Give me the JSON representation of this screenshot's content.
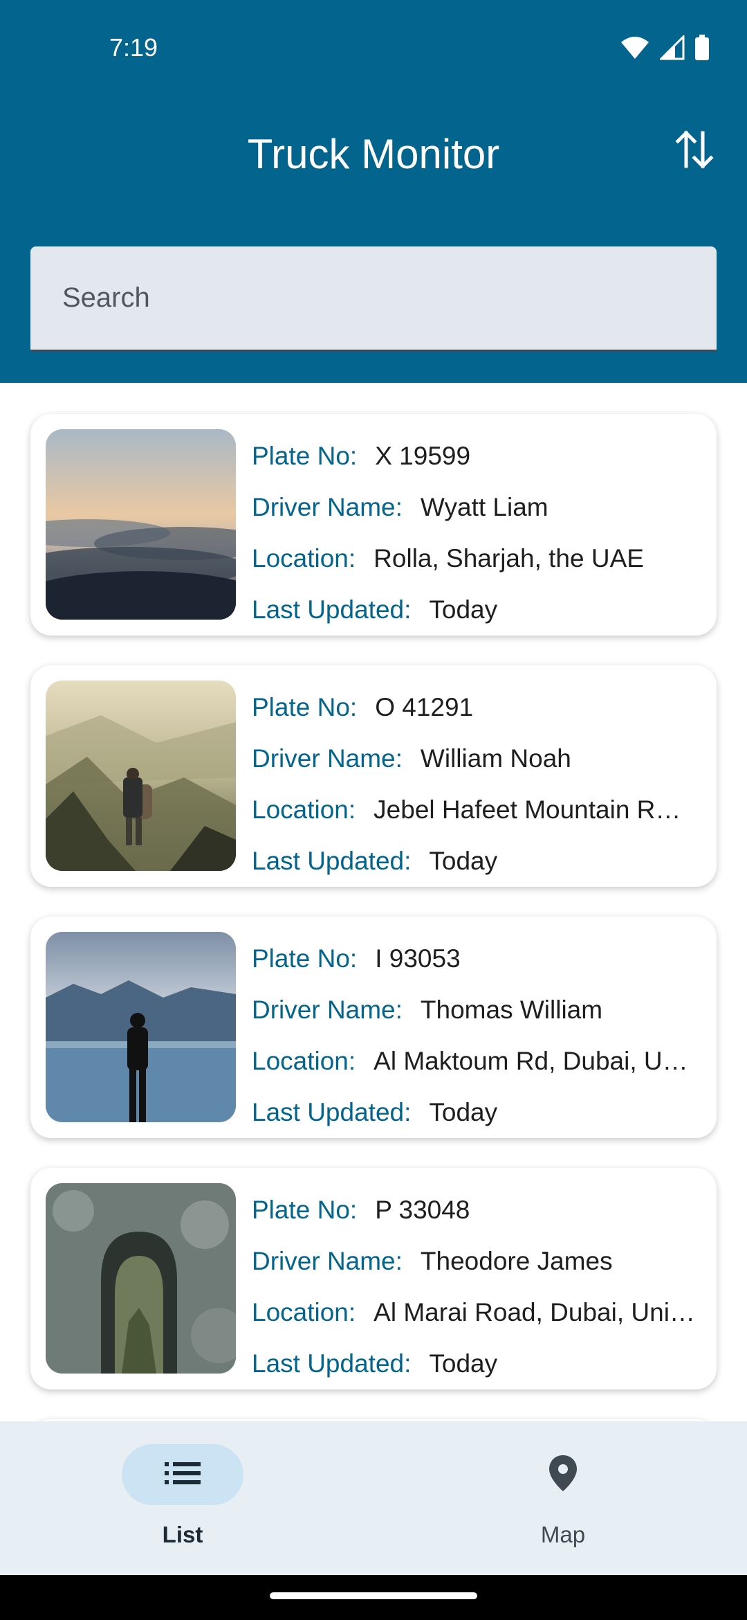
{
  "status_bar": {
    "time": "7:19",
    "wifi_icon": "wifi-icon",
    "signal_icon": "cell-signal-icon",
    "battery_icon": "battery-icon"
  },
  "header": {
    "title": "Truck Monitor",
    "sort_icon": "sort-arrows-icon",
    "bg_color": "#03648e"
  },
  "search": {
    "placeholder": "Search",
    "value": ""
  },
  "labels": {
    "plate": "Plate No:",
    "driver": "Driver Name:",
    "location": "Location:",
    "updated": "Last Updated:"
  },
  "trucks": [
    {
      "plate": "X 19599",
      "driver": "Wyatt Liam",
      "location": "Rolla, Sharjah, the UAE",
      "updated": "Today",
      "image": "clouds-at-sunset"
    },
    {
      "plate": "O 41291",
      "driver": "William Noah",
      "location": "Jebel Hafeet Mountain R…",
      "updated": "Today",
      "image": "hiker-on-mountain"
    },
    {
      "plate": "I 93053",
      "driver": "Thomas William",
      "location": "Al Maktoum Rd, Dubai, U…",
      "updated": "Today",
      "image": "person-at-lake"
    },
    {
      "plate": "P 33048",
      "driver": "Theodore James",
      "location": "Al Marai Road, Dubai, Uni…",
      "updated": "Today",
      "image": "rock-arch-cave"
    }
  ],
  "bottom_nav": {
    "items": [
      {
        "label": "List",
        "icon": "list-icon",
        "active": true
      },
      {
        "label": "Map",
        "icon": "map-pin-icon",
        "active": false
      }
    ]
  },
  "colors": {
    "accent": "#03648e",
    "nav_bg": "#e7eef4",
    "active_pill": "#cbe3f3"
  }
}
